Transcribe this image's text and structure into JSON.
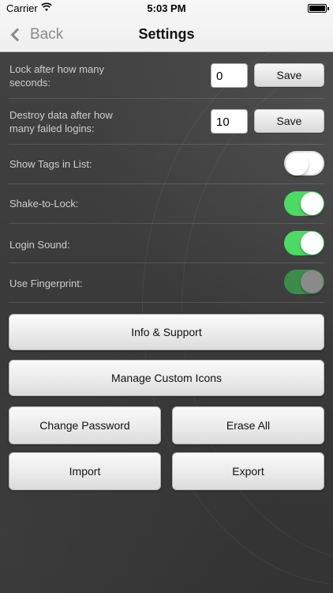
{
  "status": {
    "carrier": "Carrier",
    "time": "5:03 PM"
  },
  "nav": {
    "back_label": "Back",
    "title": "Settings"
  },
  "lock": {
    "label_line1": "Lock after how many",
    "label_line2": "seconds:",
    "value": "0",
    "save": "Save"
  },
  "destroy": {
    "label_line1": "Destroy data after how",
    "label_line2": "many failed logins:",
    "value": "10",
    "save": "Save"
  },
  "toggles": {
    "show_tags": {
      "label": "Show Tags in List:",
      "state": "off"
    },
    "shake": {
      "label": "Shake-to-Lock:",
      "state": "on"
    },
    "login_sound": {
      "label": "Login Sound:",
      "state": "on"
    },
    "fingerprint": {
      "label": "Use Fingerprint:",
      "state": "on-disabled"
    }
  },
  "buttons": {
    "info": "Info & Support",
    "icons": "Manage Custom Icons",
    "change_password": "Change Password",
    "erase_all": "Erase All",
    "import": "Import",
    "export": "Export"
  },
  "colors": {
    "toggle_on": "#4cd964",
    "toggle_disabled": "#3b8c4a",
    "background": "#3a3a3a"
  }
}
